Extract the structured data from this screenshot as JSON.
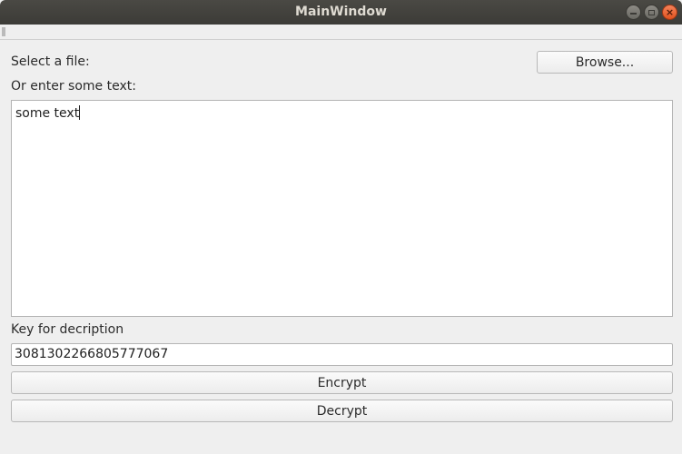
{
  "window": {
    "title": "MainWindow",
    "controls": {
      "minimize": "minimize",
      "maximize": "maximize",
      "close": "×"
    }
  },
  "form": {
    "file_label": "Select a file:",
    "browse_label": "Browse...",
    "text_label": "Or enter some text:",
    "text_value": "some text",
    "key_label": "Key for decription",
    "key_value": "3081302266805777067",
    "encrypt_label": "Encrypt",
    "decrypt_label": "Decrypt"
  },
  "colors": {
    "titlebar": "#3c3b37",
    "close_button": "#e95420",
    "window_bg": "#efefef"
  }
}
